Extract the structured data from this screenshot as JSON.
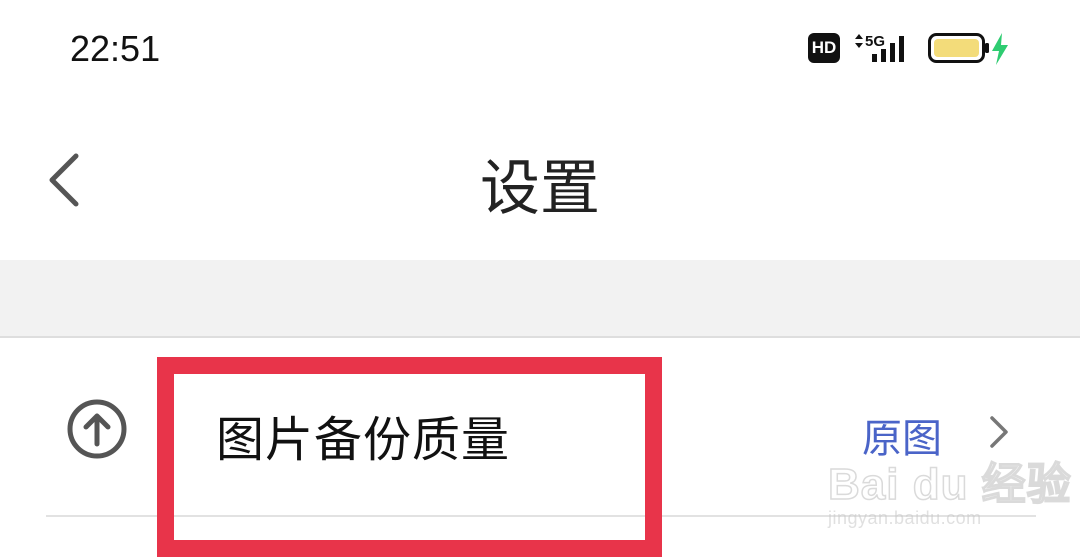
{
  "status_bar": {
    "time": "22:51",
    "hd_badge": "HD",
    "network": "5G",
    "battery_color": "#f3dc7a",
    "charging_color": "#2ecc71"
  },
  "nav": {
    "title": "设置",
    "back_icon": "chevron-left-icon"
  },
  "settings": {
    "items": [
      {
        "icon": "upload-circle-icon",
        "label": "图片备份质量",
        "value": "原图",
        "chevron": "chevron-right-icon"
      }
    ]
  },
  "annotation": {
    "highlight_color": "#e8344a"
  },
  "watermark": {
    "logo": "Bai du 经验",
    "url": "jingyan.baidu.com"
  }
}
